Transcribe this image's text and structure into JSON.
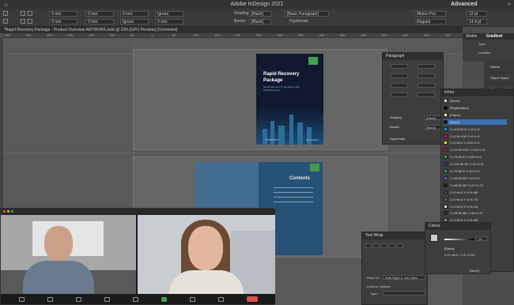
{
  "window": {
    "title": "Adobe InDesign 2021",
    "workspace": "Advanced"
  },
  "control_bar": {
    "fields": [
      "0 mm",
      "0 mm",
      "0 mm",
      "0 mm",
      "0 mm",
      "Ignore",
      "Ignore",
      "0 mm",
      "[Black]",
      "[Basic Paragraph]",
      "Minion Pro",
      "Regular",
      "12 pt",
      "14.4 pt"
    ],
    "shading_label": "Shading",
    "border_label": "Border",
    "hyphenate_label": "Hyphenate"
  },
  "doc_tab": "*Rapid Recovery Package - Product Overview ARTWORK.indd @ 23% [GPU Preview] (Converted)",
  "ruler_ticks": [
    "350",
    "300",
    "250",
    "200",
    "150",
    "100",
    "50",
    "0",
    "50",
    "100",
    "150",
    "200",
    "250",
    "300",
    "350",
    "400",
    "450",
    "500",
    "550",
    "600",
    "650",
    "700"
  ],
  "cover": {
    "title": "Rapid Recovery Package",
    "subtitle": "Accelerate your IT Operations with Rapid Recovery",
    "brand": "SYMPHONY",
    "partner": "ServiceNow"
  },
  "contents": {
    "title": "Contents"
  },
  "zoom_call": {
    "participant_count": 2
  },
  "paragraph_panel": {
    "title": "Paragraph",
    "shading": "Shading",
    "border": "Border",
    "hyphenate": "Hyphenate",
    "shading_color": "[Black]",
    "border_color": "[Black]"
  },
  "text_wrap_panel": {
    "title": "Text Wrap",
    "wrap_to": "Wrap To:",
    "wrap_value": "Both Right & Left Sides",
    "contour": "Contour Options:",
    "type": "Type:"
  },
  "colour_panel": {
    "title": "Colour",
    "value": "20",
    "swatch": "[Black]",
    "mix": "C=0, M=0, Y=0, K=20",
    "none": "[None]"
  },
  "right_tabs": [
    "Stroke",
    "Gradient"
  ],
  "right_top": {
    "type": "Type:",
    "location": "Location:"
  },
  "side_panel": [
    "Effects",
    "Object Styles",
    "Paragraph Styles",
    "Review"
  ],
  "swatches": {
    "title": "tches",
    "items": [
      {
        "name": "[None]",
        "color": "#ffffff"
      },
      {
        "name": "[Registration]",
        "color": "#000000"
      },
      {
        "name": "[Paper]",
        "color": "#ffffff"
      },
      {
        "name": "[Black]",
        "color": "#000000"
      },
      {
        "name": "C=100 M=0 Y=0 K=0",
        "color": "#00a0e3"
      },
      {
        "name": "C=0 M=100 Y=0 K=0",
        "color": "#e4007f"
      },
      {
        "name": "C=0 M=0 Y=100 K=0",
        "color": "#ffed00"
      },
      {
        "name": "C=15 M=100 Y=100 K=0",
        "color": "#c8102e"
      },
      {
        "name": "C=75 M=5 Y=100 K=0",
        "color": "#3fa34d"
      },
      {
        "name": "C=100 M=90 Y=10 K=0",
        "color": "#1d3d8f"
      },
      {
        "name": "C=75 M=0 Y=67 K=0",
        "color": "#00a77f"
      },
      {
        "name": "C=65 M=60 Y=0 K=0",
        "color": "#6b5fae"
      },
      {
        "name": "C=88 M=80 Y=47 K=72",
        "color": "#0f1a2e"
      },
      {
        "name": "C=0 M=0 Y=0 K=80",
        "color": "#474747"
      },
      {
        "name": "C=0 M=0 Y=0 K=70",
        "color": "#5f5f5f"
      },
      {
        "name": "C=0 M=0 Y=0 K=15",
        "color": "#dadada"
      },
      {
        "name": "C=98 M=88 Y=44 K=27",
        "color": "#1e2f55"
      },
      {
        "name": "C=0 M=0 Y=0 K=50",
        "color": "#8c8c8c"
      },
      {
        "name": "C=0 M=0 Y=0 K=15",
        "color": "#dadada"
      },
      {
        "name": "C=94 M=75 Y=13 K=0",
        "color": "#1f4f9a"
      },
      {
        "name": "C=56 M=32 Y=5 K=0",
        "color": "#7ea3d2"
      }
    ]
  }
}
